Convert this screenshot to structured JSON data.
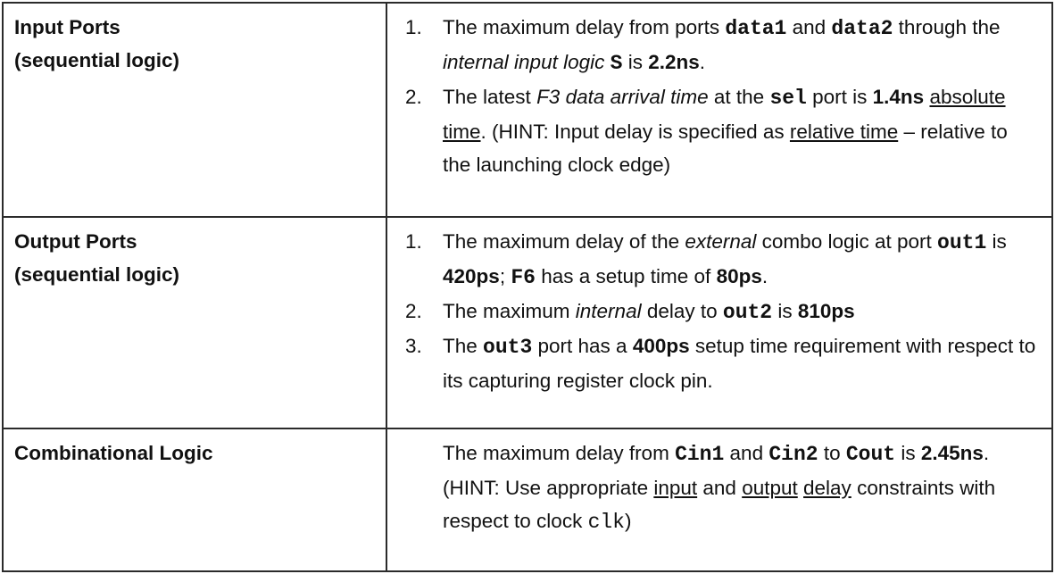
{
  "rows": [
    {
      "category": [
        "Input Ports",
        "(sequential logic)"
      ],
      "items": [
        {
          "number": "1.",
          "parts": [
            {
              "t": "The maximum delay from ports ",
              "s": ""
            },
            {
              "t": "data1",
              "s": "mb"
            },
            {
              "t": " and ",
              "s": ""
            },
            {
              "t": "data2",
              "s": "mb"
            },
            {
              "t": " through the ",
              "s": ""
            },
            {
              "t": "internal input logic",
              "s": "i"
            },
            {
              "t": " ",
              "s": ""
            },
            {
              "t": "S",
              "s": "mb"
            },
            {
              "t": " is ",
              "s": ""
            },
            {
              "t": "2.2ns",
              "s": "b"
            },
            {
              "t": ".",
              "s": ""
            }
          ]
        },
        {
          "number": "2.",
          "parts": [
            {
              "t": "The latest ",
              "s": ""
            },
            {
              "t": "F3 data arrival time",
              "s": "i"
            },
            {
              "t": " at the ",
              "s": ""
            },
            {
              "t": "sel",
              "s": "mb"
            },
            {
              "t": " port is ",
              "s": ""
            },
            {
              "t": "1.4ns",
              "s": "b"
            },
            {
              "t": " ",
              "s": ""
            },
            {
              "t": "absolute time",
              "s": "u"
            },
            {
              "t": ". (HINT: Input delay is specified as ",
              "s": ""
            },
            {
              "t": "relative time",
              "s": "u"
            },
            {
              "t": " – relative to the launching clock edge)",
              "s": ""
            }
          ]
        }
      ]
    },
    {
      "category": [
        "Output Ports",
        "(sequential logic)"
      ],
      "items": [
        {
          "number": "1.",
          "parts": [
            {
              "t": "The maximum delay of the ",
              "s": ""
            },
            {
              "t": "external",
              "s": "i"
            },
            {
              "t": " combo logic at port ",
              "s": ""
            },
            {
              "t": "out1",
              "s": "mb"
            },
            {
              "t": " is ",
              "s": ""
            },
            {
              "t": "420ps",
              "s": "b"
            },
            {
              "t": "; ",
              "s": ""
            },
            {
              "t": "F6",
              "s": "mb"
            },
            {
              "t": " has a setup time of ",
              "s": ""
            },
            {
              "t": "80ps",
              "s": "b"
            },
            {
              "t": ".",
              "s": ""
            }
          ]
        },
        {
          "number": "2.",
          "parts": [
            {
              "t": "The maximum ",
              "s": ""
            },
            {
              "t": "internal",
              "s": "i"
            },
            {
              "t": " delay to ",
              "s": ""
            },
            {
              "t": "out2",
              "s": "mb"
            },
            {
              "t": " is ",
              "s": ""
            },
            {
              "t": "810ps",
              "s": "b"
            }
          ]
        },
        {
          "number": "3.",
          "parts": [
            {
              "t": "The ",
              "s": ""
            },
            {
              "t": "out3",
              "s": "mb"
            },
            {
              "t": " port has a ",
              "s": ""
            },
            {
              "t": "400ps",
              "s": "b"
            },
            {
              "t": " setup time requirement with respect to its capturing register clock pin.",
              "s": ""
            }
          ]
        }
      ]
    },
    {
      "category": [
        "Combinational Logic"
      ],
      "items": [
        {
          "number": "",
          "parts": [
            {
              "t": "The maximum delay from ",
              "s": ""
            },
            {
              "t": "Cin1",
              "s": "mb"
            },
            {
              "t": " and ",
              "s": ""
            },
            {
              "t": "Cin2",
              "s": "mb"
            },
            {
              "t": " to ",
              "s": ""
            },
            {
              "t": "Cout",
              "s": "mb"
            },
            {
              "t": " is ",
              "s": ""
            },
            {
              "t": "2.45ns",
              "s": "b"
            },
            {
              "t": ". (HINT: Use appropriate ",
              "s": ""
            },
            {
              "t": "input",
              "s": "u"
            },
            {
              "t": " and ",
              "s": ""
            },
            {
              "t": "output",
              "s": "u"
            },
            {
              "t": " ",
              "s": ""
            },
            {
              "t": "delay",
              "s": "u"
            },
            {
              "t": " constraints with respect to clock ",
              "s": ""
            },
            {
              "t": "clk",
              "s": "m"
            },
            {
              "t": ")",
              "s": ""
            }
          ]
        }
      ]
    }
  ]
}
